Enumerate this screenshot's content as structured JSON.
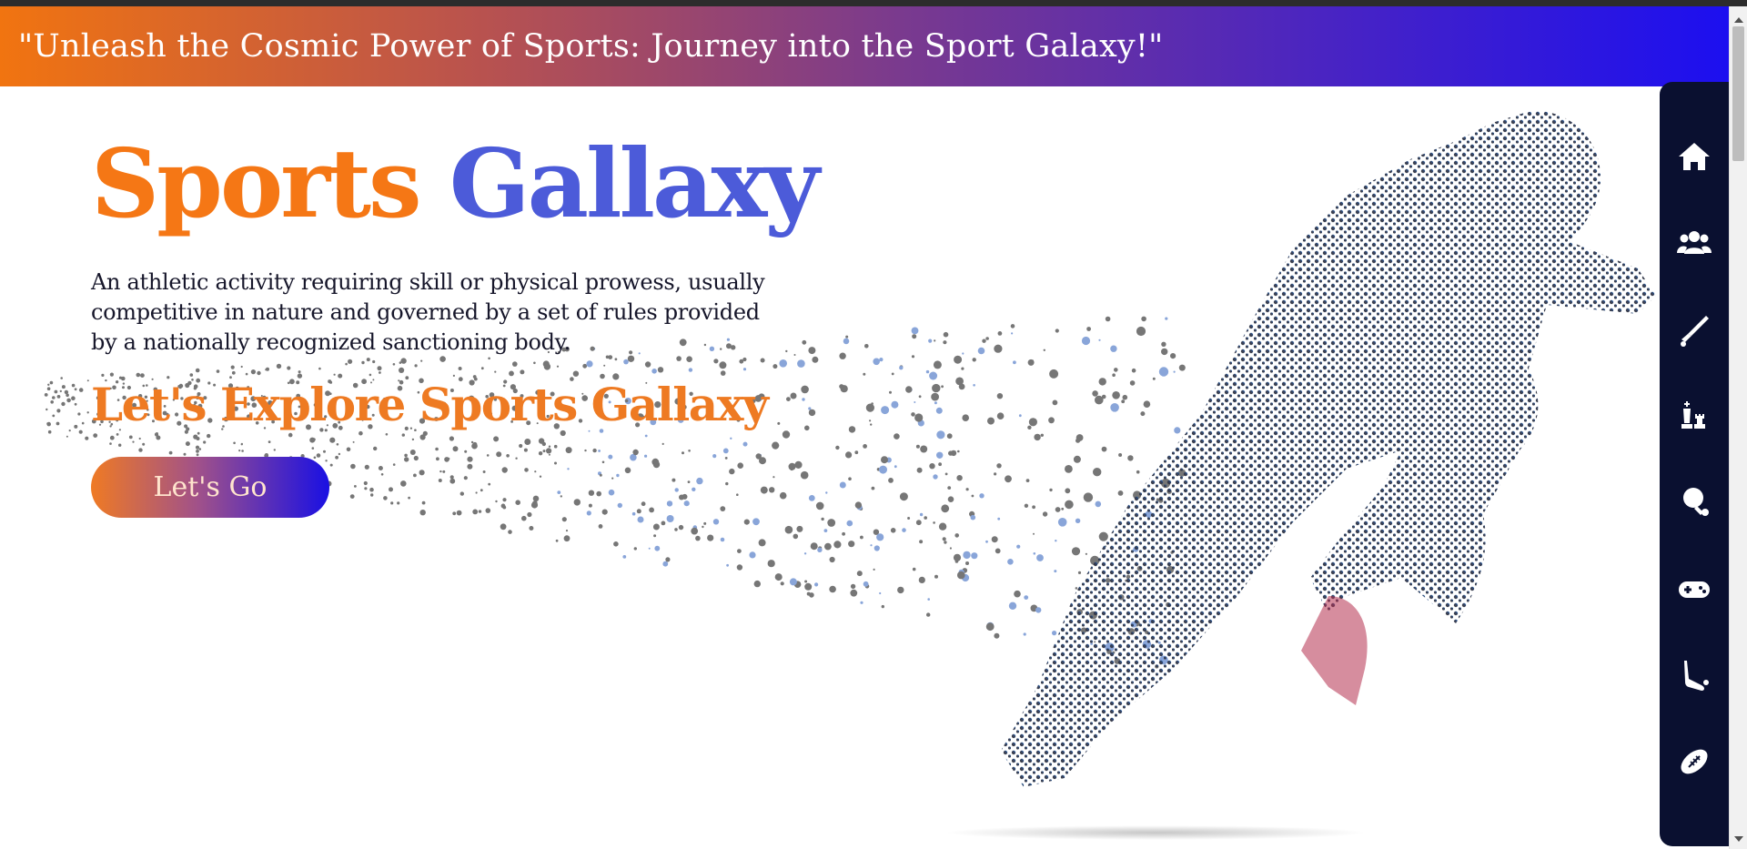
{
  "banner": {
    "text": "\"Unleash the Cosmic Power of Sports: Journey into the Sport Galaxy!\""
  },
  "hero": {
    "title_part1": "Sports",
    "title_part2": "Gallaxy",
    "description": "An athletic activity requiring skill or physical prowess, usually competitive in nature and governed by a set of rules provided by a nationally recognized sanctioning body.",
    "explore_heading": "Let's Explore Sports Gallaxy",
    "cta_label": "Let's Go"
  },
  "sidebar": {
    "items": [
      {
        "icon": "home-icon"
      },
      {
        "icon": "users-icon"
      },
      {
        "icon": "cricket-bat-icon"
      },
      {
        "icon": "chess-icon"
      },
      {
        "icon": "table-tennis-icon"
      },
      {
        "icon": "gamepad-icon"
      },
      {
        "icon": "hockey-stick-icon"
      },
      {
        "icon": "football-icon"
      }
    ]
  },
  "colors": {
    "accent_orange": "#f57715",
    "accent_blue": "#4c5bd9",
    "sidebar_bg": "#0a1030",
    "banner_gradient_start": "#f17410",
    "banner_gradient_end": "#1c0ff0"
  }
}
